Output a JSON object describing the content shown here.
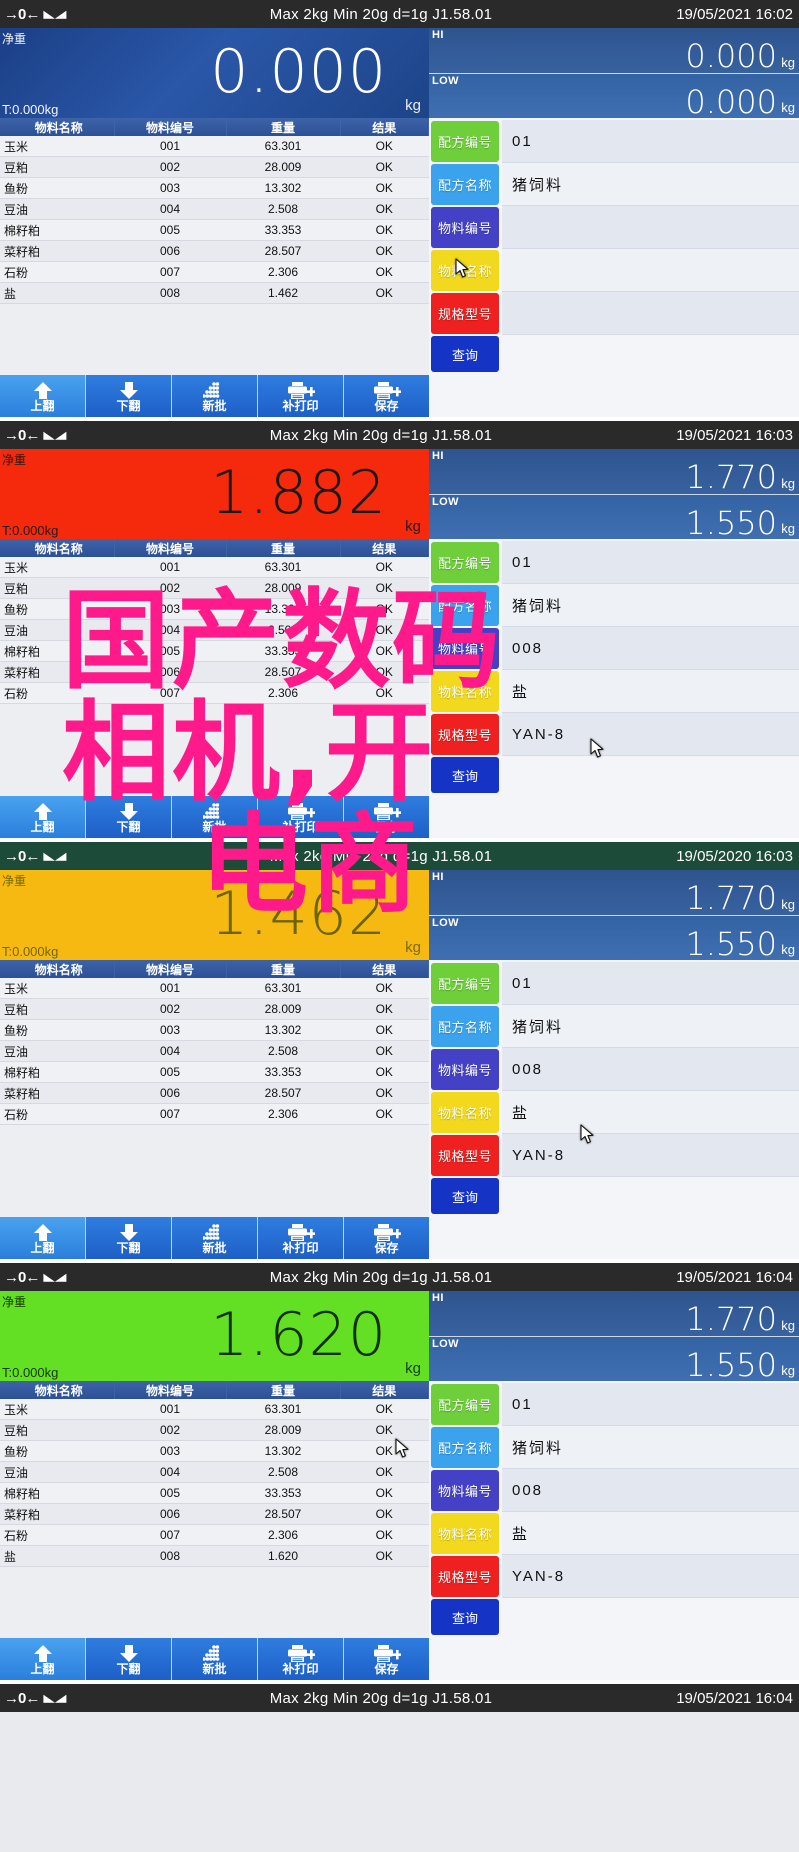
{
  "watermark": {
    "line1": "国产数码",
    "line2": "相机,开",
    "line3": "电商",
    "color": "#ff1a8c"
  },
  "labels": {
    "mode_net": "净重",
    "tare_prefix": "T:0.000kg",
    "unit_kg": "kg",
    "hi_tag": "HI",
    "low_tag": "LOW",
    "zero_icon": "→0←",
    "stable_icon": "◣◢"
  },
  "spec": {
    "text": "Max 2kg  Min 20g  d=1g    J1.58.01",
    "max": "Max 2kg",
    "min": "Min 20g",
    "division": "d=1g",
    "version": "J1.58.01"
  },
  "table_headers": [
    "物料名称",
    "物料编号",
    "重量",
    "结果"
  ],
  "form_labels": {
    "recipe_code": "配方编号",
    "recipe_name": "配方名称",
    "material_code": "物料编号",
    "material_name": "物料名称",
    "spec_model": "规格型号",
    "query": "查询"
  },
  "form_colors": {
    "recipe_code": "#6ecf3a",
    "recipe_name": "#3ba3ed",
    "material_code": "#4441c6",
    "material_name": "#f2d91e",
    "spec_model": "#ef2020",
    "query": "#1533c4"
  },
  "toolbar": [
    {
      "label": "上翻",
      "icon": "arrow-up-icon"
    },
    {
      "label": "下翻",
      "icon": "arrow-down-icon"
    },
    {
      "label": "新批",
      "icon": "stack-pile-icon"
    },
    {
      "label": "补打印",
      "icon": "printer-plus-icon"
    },
    {
      "label": "保存",
      "icon": "printer-plus-icon"
    }
  ],
  "panels": [
    {
      "datetime": "19/05/2021  16:02",
      "statusbar_color": "#2a2a2a",
      "weight": "0.000",
      "weight_color": "#1d4488",
      "weight_state": "blue",
      "tare": "T:0.000kg",
      "hi": "0.000",
      "low": "0.000",
      "rows": [
        {
          "name": "玉米",
          "code": "001",
          "weight": "63.301",
          "result": "OK"
        },
        {
          "name": "豆粕",
          "code": "002",
          "weight": "28.009",
          "result": "OK"
        },
        {
          "name": "鱼粉",
          "code": "003",
          "weight": "13.302",
          "result": "OK"
        },
        {
          "name": "豆油",
          "code": "004",
          "weight": "2.508",
          "result": "OK"
        },
        {
          "name": "棉籽粕",
          "code": "005",
          "weight": "33.353",
          "result": "OK"
        },
        {
          "name": "菜籽粕",
          "code": "006",
          "weight": "28.507",
          "result": "OK"
        },
        {
          "name": "石粉",
          "code": "007",
          "weight": "2.306",
          "result": "OK"
        },
        {
          "name": "盐",
          "code": "008",
          "weight": "1.462",
          "result": "OK"
        }
      ],
      "form": {
        "recipe_code": "01",
        "recipe_name": "猪饲料",
        "material_code": "",
        "material_name": "",
        "spec_model": ""
      }
    },
    {
      "datetime": "19/05/2021  16:03",
      "statusbar_color": "#2a2a2a",
      "weight": "1.882",
      "weight_color": "#f5290c",
      "weight_state": "red",
      "tare": "T:0.000kg",
      "hi": "1.770",
      "low": "1.550",
      "rows": [
        {
          "name": "玉米",
          "code": "001",
          "weight": "63.301",
          "result": "OK"
        },
        {
          "name": "豆粕",
          "code": "002",
          "weight": "28.009",
          "result": "OK"
        },
        {
          "name": "鱼粉",
          "code": "003",
          "weight": "13.302",
          "result": "OK"
        },
        {
          "name": "豆油",
          "code": "004",
          "weight": "2.508",
          "result": "OK"
        },
        {
          "name": "棉籽粕",
          "code": "005",
          "weight": "33.353",
          "result": "OK"
        },
        {
          "name": "菜籽粕",
          "code": "006",
          "weight": "28.507",
          "result": "OK"
        },
        {
          "name": "石粉",
          "code": "007",
          "weight": "2.306",
          "result": "OK"
        }
      ],
      "form": {
        "recipe_code": "01",
        "recipe_name": "猪饲料",
        "material_code": "008",
        "material_name": "盐",
        "spec_model": "YAN-8"
      }
    },
    {
      "datetime": "19/05/2020  16:03",
      "statusbar_color": "#1d4b3a",
      "weight": "1.462",
      "weight_color": "#f6b912",
      "weight_state": "yellow",
      "tare": "T:0.000kg",
      "hi": "1.770",
      "low": "1.550",
      "rows": [
        {
          "name": "玉米",
          "code": "001",
          "weight": "63.301",
          "result": "OK"
        },
        {
          "name": "豆粕",
          "code": "002",
          "weight": "28.009",
          "result": "OK"
        },
        {
          "name": "鱼粉",
          "code": "003",
          "weight": "13.302",
          "result": "OK"
        },
        {
          "name": "豆油",
          "code": "004",
          "weight": "2.508",
          "result": "OK"
        },
        {
          "name": "棉籽粕",
          "code": "005",
          "weight": "33.353",
          "result": "OK"
        },
        {
          "name": "菜籽粕",
          "code": "006",
          "weight": "28.507",
          "result": "OK"
        },
        {
          "name": "石粉",
          "code": "007",
          "weight": "2.306",
          "result": "OK"
        }
      ],
      "form": {
        "recipe_code": "01",
        "recipe_name": "猪饲料",
        "material_code": "008",
        "material_name": "盐",
        "spec_model": "YAN-8"
      }
    },
    {
      "datetime": "19/05/2021  16:04",
      "statusbar_color": "#2a2a2a",
      "weight": "1.620",
      "weight_color": "#63e024",
      "weight_state": "green",
      "tare": "T:0.000kg",
      "hi": "1.770",
      "low": "1.550",
      "rows": [
        {
          "name": "玉米",
          "code": "001",
          "weight": "63.301",
          "result": "OK"
        },
        {
          "name": "豆粕",
          "code": "002",
          "weight": "28.009",
          "result": "OK"
        },
        {
          "name": "鱼粉",
          "code": "003",
          "weight": "13.302",
          "result": "OK"
        },
        {
          "name": "豆油",
          "code": "004",
          "weight": "2.508",
          "result": "OK"
        },
        {
          "name": "棉籽粕",
          "code": "005",
          "weight": "33.353",
          "result": "OK"
        },
        {
          "name": "菜籽粕",
          "code": "006",
          "weight": "28.507",
          "result": "OK"
        },
        {
          "name": "石粉",
          "code": "007",
          "weight": "2.306",
          "result": "OK"
        },
        {
          "name": "盐",
          "code": "008",
          "weight": "1.620",
          "result": "OK"
        }
      ],
      "form": {
        "recipe_code": "01",
        "recipe_name": "猪饲料",
        "material_code": "008",
        "material_name": "盐",
        "spec_model": "YAN-8"
      }
    },
    {
      "datetime": "19/05/2021  16:04",
      "statusbar_color": "#2a2a2a",
      "spec_only": true
    }
  ]
}
